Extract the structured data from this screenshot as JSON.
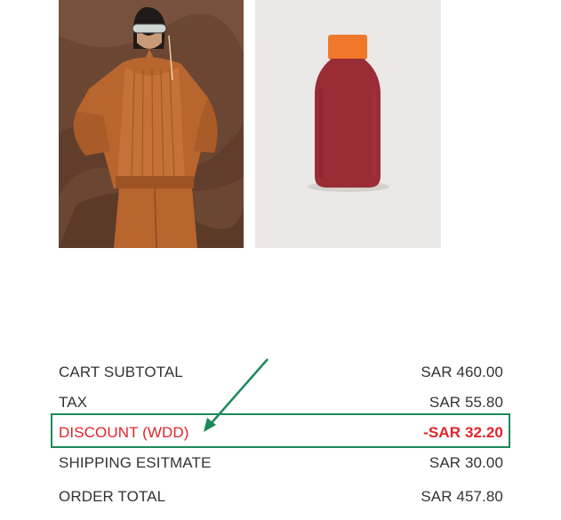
{
  "products": [
    {
      "name": "jacket-model-photo",
      "alt": "Model wearing rust satin jacket"
    },
    {
      "name": "red-bottle-photo",
      "alt": "Red insulated bottle with orange cap"
    }
  ],
  "summary": {
    "subtotal": {
      "label": "CART SUBTOTAL",
      "value": "SAR 460.00"
    },
    "tax": {
      "label": "TAX",
      "value": "SAR 55.80"
    },
    "discount": {
      "label": "DISCOUNT (WDD)",
      "value": "-SAR 32.20"
    },
    "shipping": {
      "label": "SHIPPING ESITMATE",
      "value": "SAR 30.00"
    },
    "total": {
      "label": "ORDER TOTAL",
      "value": "SAR 457.80"
    }
  },
  "colors": {
    "discount_text": "#e0242b",
    "highlight": "#1a8a5a",
    "text": "#333333"
  }
}
